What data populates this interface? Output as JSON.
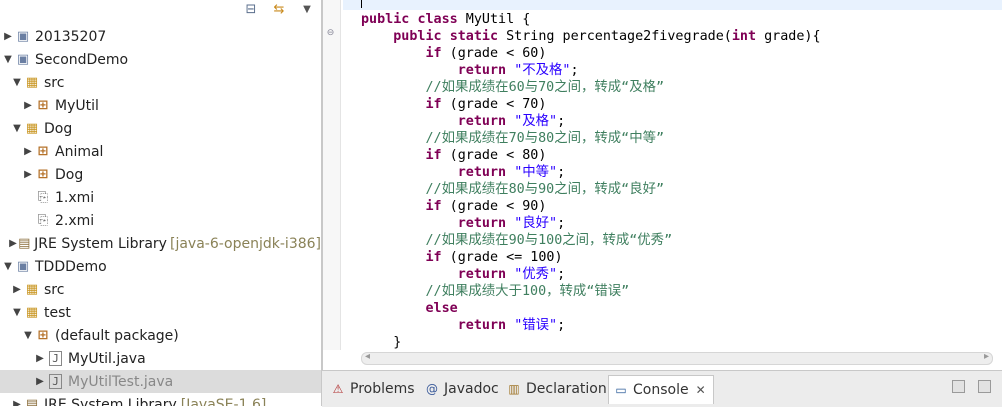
{
  "explorer": {
    "tree": [
      {
        "label": "20135207",
        "icon": "project-icon",
        "expanded": false
      },
      {
        "label": "SecondDemo",
        "icon": "project-icon",
        "expanded": true
      },
      {
        "label": "src",
        "icon": "source-folder-icon",
        "expanded": true
      },
      {
        "label": "MyUtil",
        "icon": "package-icon",
        "expanded": false
      },
      {
        "label": "Dog",
        "icon": "source-folder-icon",
        "expanded": true
      },
      {
        "label": "Animal",
        "icon": "package-icon",
        "expanded": false
      },
      {
        "label": "Dog",
        "icon": "package-icon",
        "expanded": false
      },
      {
        "label": "1.xmi",
        "icon": "xmi-file-icon"
      },
      {
        "label": "2.xmi",
        "icon": "xmi-file-icon"
      },
      {
        "label": "JRE System Library",
        "suffix": "[java-6-openjdk-i386]",
        "icon": "library-icon",
        "expanded": false
      },
      {
        "label": "TDDDemo",
        "icon": "project-icon",
        "expanded": true
      },
      {
        "label": "src",
        "icon": "source-folder-icon",
        "expanded": false
      },
      {
        "label": "test",
        "icon": "source-folder-icon",
        "expanded": true
      },
      {
        "label": "(default package)",
        "icon": "package-icon",
        "expanded": true
      },
      {
        "label": "MyUtil.java",
        "icon": "java-file-icon",
        "expanded": false
      },
      {
        "label": "MyUtilTest.java",
        "icon": "java-file-icon",
        "expanded": false,
        "selected": true
      },
      {
        "label": "JRE System Library",
        "suffix": "[JavaSE-1.6]",
        "icon": "library-icon",
        "expanded": false
      }
    ]
  },
  "editor": {
    "lines": [
      "",
      "public class MyUtil {",
      "    public static String percentage2fivegrade(int grade){",
      "        if (grade < 60)",
      "            return \"不及格\";",
      "        //如果成绩在60与70之间，转成“及格”",
      "        if (grade < 70)",
      "            return \"及格\";",
      "        //如果成绩在70与80之间，转成“中等”",
      "        if (grade < 80)",
      "            return \"中等\";",
      "        //如果成绩在80与90之间，转成“良好”",
      "        if (grade < 90)",
      "            return \"良好\";",
      "        //如果成绩在90与100之间，转成“优秀”",
      "        if (grade <= 100)",
      "            return \"优秀\";",
      "        //如果成绩大于100，转成“错误”",
      "        else",
      "            return \"错误\";",
      "    }"
    ]
  },
  "views": {
    "tabs": [
      {
        "label": "Problems",
        "icon": "problems-icon"
      },
      {
        "label": "Javadoc",
        "icon": "javadoc-icon"
      },
      {
        "label": "Declaration",
        "icon": "declaration-icon"
      },
      {
        "label": "Console",
        "icon": "console-icon",
        "active": true
      }
    ]
  },
  "colors": {
    "keyword": "#7f0055",
    "string": "#2a00ff",
    "comment": "#3f7f5f",
    "selection": "#dcdcdc",
    "current_line": "#e8f2fe"
  }
}
